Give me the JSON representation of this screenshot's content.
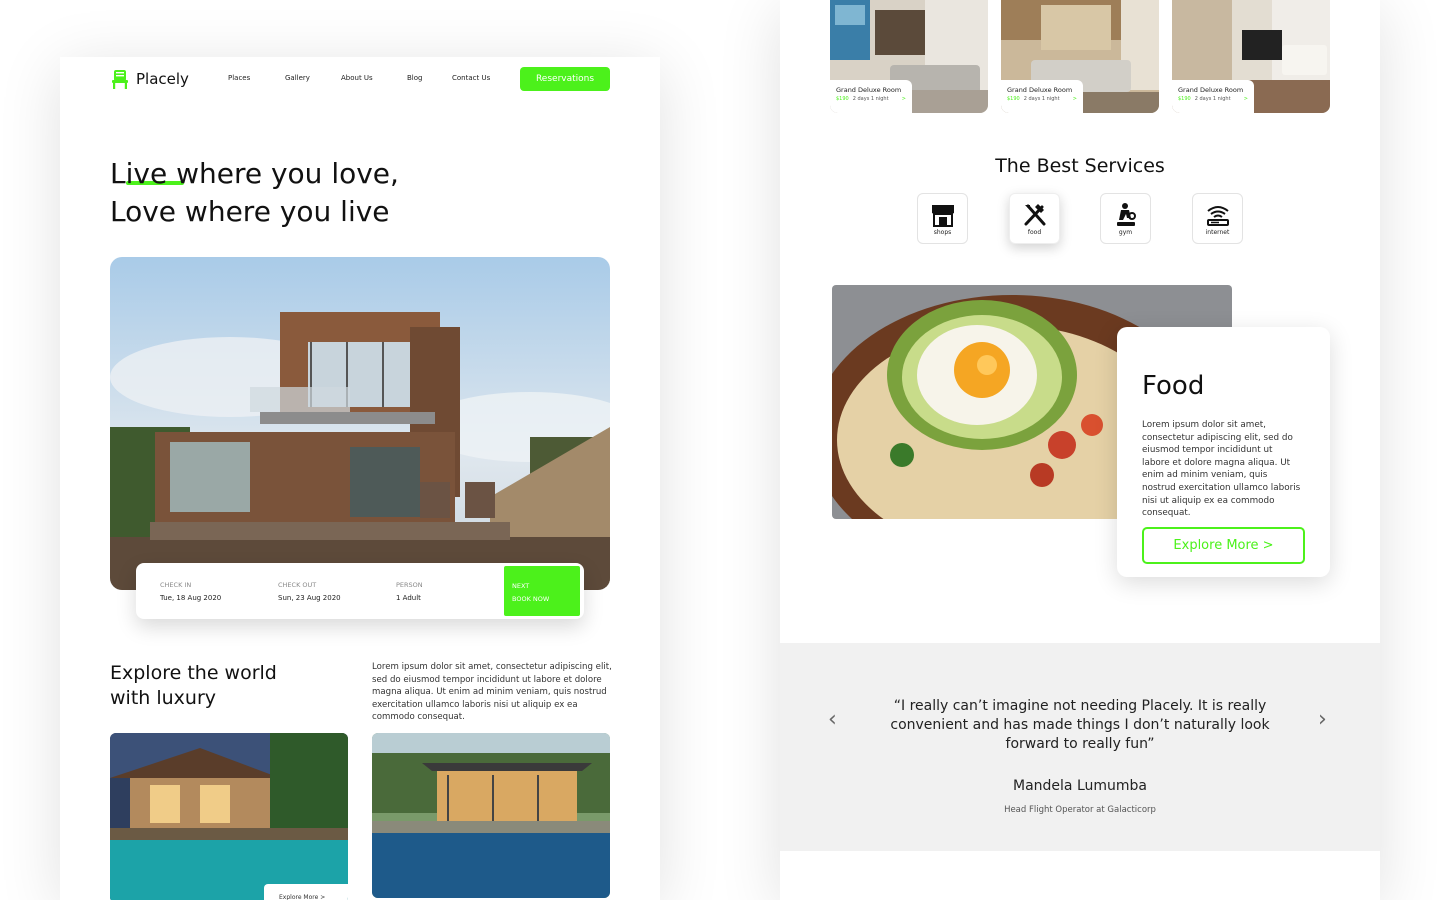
{
  "brand": {
    "name": "Placely",
    "accent": "#4cf11b"
  },
  "nav": {
    "items": [
      "Places",
      "Gallery",
      "About Us",
      "Blog",
      "Contact Us"
    ],
    "cta": "Reservations"
  },
  "hero": {
    "line1": "Live where you love,",
    "line2": "Love where you live"
  },
  "booking": {
    "checkin_label": "CHECK IN",
    "checkin_value": "Tue, 18 Aug 2020",
    "checkout_label": "CHECK OUT",
    "checkout_value": "Sun, 23 Aug 2020",
    "person_label": "PERSON",
    "person_value": "1 Adult",
    "next_label": "NEXT",
    "next_action": "BOOK NOW"
  },
  "explore": {
    "title_line1": "Explore the world",
    "title_line2": "with luxury",
    "body": "Lorem ipsum dolor sit amet, consectetur adipiscing elit, sed do eiusmod tempor incididunt ut labore et dolore magna aliqua. Ut enim ad minim veniam, quis nostrud exercitation ullamco laboris nisi ut aliquip ex ea commodo consequat.",
    "thumb_link": "Explore More >"
  },
  "rooms": [
    {
      "name": "Grand Deluxe Room",
      "price": "$190",
      "stay": "2 days 1 night",
      "arrow": ">"
    },
    {
      "name": "Grand Deluxe Room",
      "price": "$190",
      "stay": "2 days 1 night",
      "arrow": ">"
    },
    {
      "name": "Grand Deluxe Room",
      "price": "$190",
      "stay": "2 days 1 night",
      "arrow": ">"
    }
  ],
  "services": {
    "title": "The Best Services",
    "items": [
      {
        "label": "shops",
        "icon": "shop-icon"
      },
      {
        "label": "food",
        "icon": "fork-knife-icon"
      },
      {
        "label": "gym",
        "icon": "gym-icon"
      },
      {
        "label": "internet",
        "icon": "wifi-icon"
      }
    ]
  },
  "food": {
    "title": "Food",
    "body": "Lorem ipsum dolor sit amet, consectetur adipiscing elit, sed do eiusmod tempor incididunt ut labore et dolore magna aliqua. Ut enim ad minim veniam, quis nostrud exercitation ullamco laboris nisi ut aliquip ex ea commodo consequat.",
    "button": "Explore More >"
  },
  "testimonial": {
    "quote": "“I really can’t imagine not needing Placely. It is really convenient and has made things I don’t naturally look forward to really fun”",
    "name": "Mandela Lumumba",
    "role": "Head Flight Operator at Galacticorp",
    "prev": "‹",
    "next": "›"
  }
}
